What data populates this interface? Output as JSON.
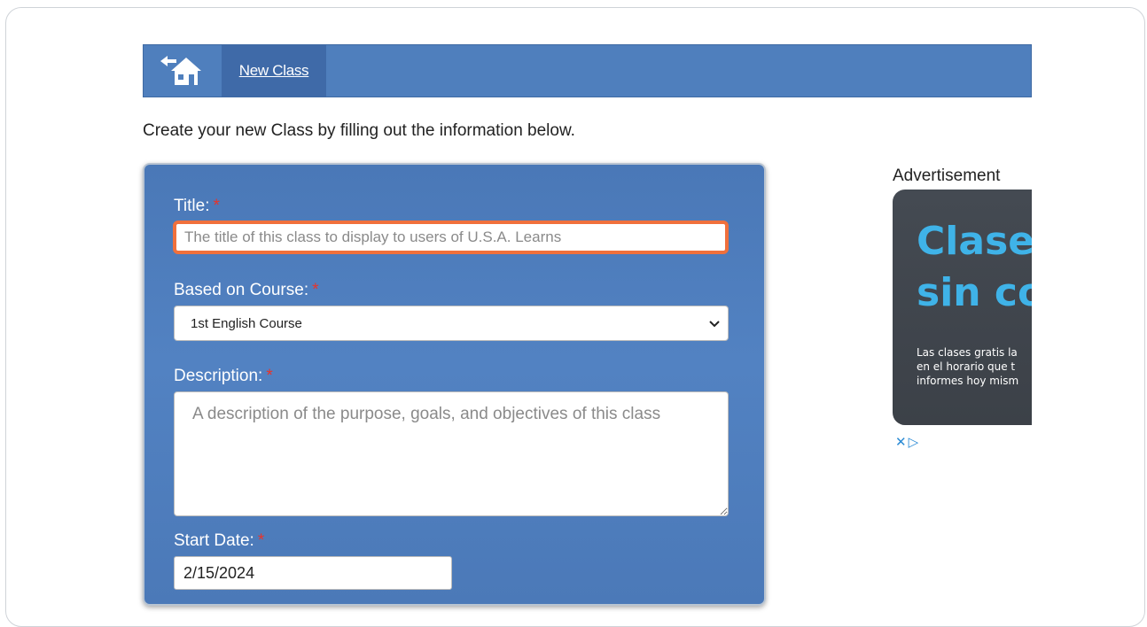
{
  "nav": {
    "home_icon": "home-back-icon",
    "tab_label": "New Class"
  },
  "intro_text": "Create your new Class by filling out the information below.",
  "form": {
    "title": {
      "label": "Title:",
      "required_mark": "*",
      "placeholder": "The title of this class to display to users of U.S.A. Learns",
      "value": ""
    },
    "course": {
      "label": "Based on Course:",
      "required_mark": "*",
      "selected": "1st English Course"
    },
    "description": {
      "label": "Description:",
      "required_mark": "*",
      "placeholder": "A description of the purpose, goals, and objectives of this class",
      "value": ""
    },
    "start_date": {
      "label": "Start Date:",
      "required_mark": "*",
      "value": "2/15/2024"
    }
  },
  "ad": {
    "label": "Advertisement",
    "headline_1": "Clases",
    "headline_2": "sin co",
    "body_1": "Las clases gratis la",
    "body_2": "en el horario que t",
    "body_3": "informes hoy mism",
    "close_icon": "close-icon",
    "adchoices_icon": "adchoices-icon"
  },
  "colors": {
    "nav_bg": "#4f7fbd",
    "tab_bg": "#3f6aa8",
    "panel_bg": "#4f7fbd",
    "focus_border": "#f0703c",
    "required": "#e8342a",
    "ad_accent": "#3fb3e8"
  }
}
